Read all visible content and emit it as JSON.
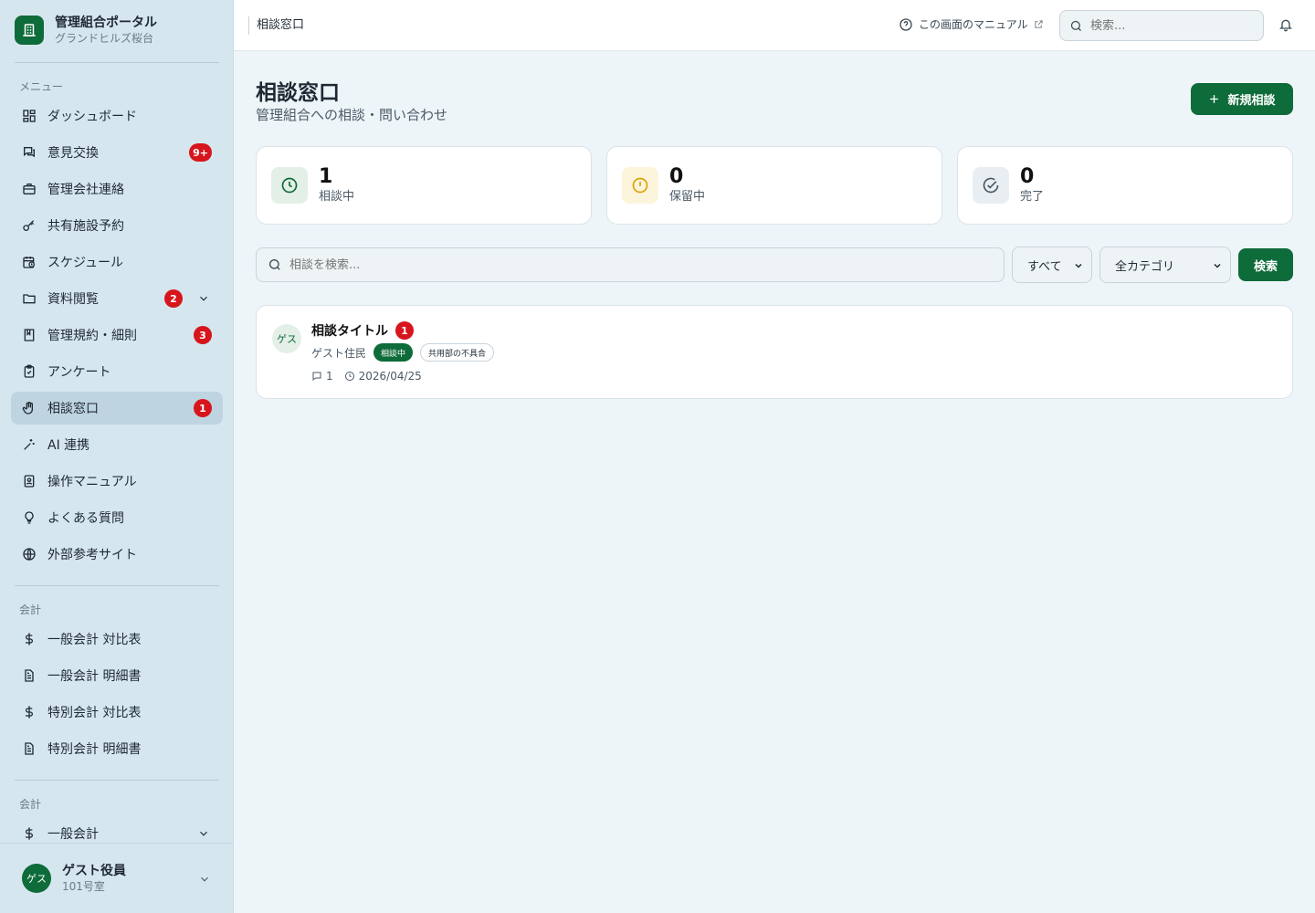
{
  "app": {
    "title": "管理組合ポータル",
    "subtitle": "グランドヒルズ桜台"
  },
  "sidebar": {
    "section_menu": "メニュー",
    "items": [
      {
        "label": "ダッシュボード",
        "icon": "dashboard-icon"
      },
      {
        "label": "意見交換",
        "icon": "chat-icon",
        "badge": "9+"
      },
      {
        "label": "管理会社連絡",
        "icon": "briefcase-icon"
      },
      {
        "label": "共有施設予約",
        "icon": "key-icon"
      },
      {
        "label": "スケジュール",
        "icon": "calendar-clock-icon"
      },
      {
        "label": "資料閲覧",
        "icon": "folder-icon",
        "badge": "2"
      },
      {
        "label": "管理規約・細則",
        "icon": "book-icon",
        "badge": "3"
      },
      {
        "label": "アンケート",
        "icon": "clipboard-icon"
      },
      {
        "label": "相談窓口",
        "icon": "hand-icon",
        "badge": "1",
        "active": true
      },
      {
        "label": "AI 連携",
        "icon": "sparkle-icon"
      },
      {
        "label": "操作マニュアル",
        "icon": "manual-icon"
      },
      {
        "label": "よくある質問",
        "icon": "lightbulb-icon"
      },
      {
        "label": "外部参考サイト",
        "icon": "globe-icon"
      }
    ],
    "section_accounting": "会計",
    "accounting_items": [
      {
        "label": "一般会計 対比表",
        "icon": "dollar-icon"
      },
      {
        "label": "一般会計 明細書",
        "icon": "document-icon"
      },
      {
        "label": "特別会計 対比表",
        "icon": "dollar-icon"
      },
      {
        "label": "特別会計 明細書",
        "icon": "document-icon"
      }
    ],
    "section_accounting2": "会計",
    "accounting2_items": [
      {
        "label": "一般会計",
        "icon": "dollar-icon"
      }
    ],
    "user": {
      "avatar": "ゲス",
      "name": "ゲスト役員",
      "room": "101号室"
    }
  },
  "header": {
    "breadcrumb": "相談窓口",
    "manual_link": "この画面のマニュアル",
    "search_placeholder": "検索..."
  },
  "main": {
    "title": "相談窓口",
    "subtitle": "管理組合への相談・問い合わせ",
    "new_button": "新規相談",
    "stats": [
      {
        "value": "1",
        "label": "相談中",
        "icon": "clock-icon",
        "color": "#0e6b3a"
      },
      {
        "value": "0",
        "label": "保留中",
        "icon": "alert-circle-icon",
        "color": "#d9a300"
      },
      {
        "value": "0",
        "label": "完了",
        "icon": "check-circle-icon",
        "color": "#4b5a66"
      }
    ],
    "search_placeholder": "相談を検索...",
    "status_filter": "すべて",
    "category_filter": "全カテゴリ",
    "search_button": "検索",
    "consultations": [
      {
        "avatar": "ゲス",
        "title": "相談タイトル",
        "unread": "1",
        "author": "ゲスト住民",
        "status": "相談中",
        "category": "共用部の不具合",
        "comments": "1",
        "date": "2026/04/25"
      }
    ]
  },
  "colors": {
    "brand": "#0e6b3a",
    "badge": "#d7151c",
    "sidebar_bg": "#d6e6ef",
    "page_bg": "#eef5f9"
  }
}
